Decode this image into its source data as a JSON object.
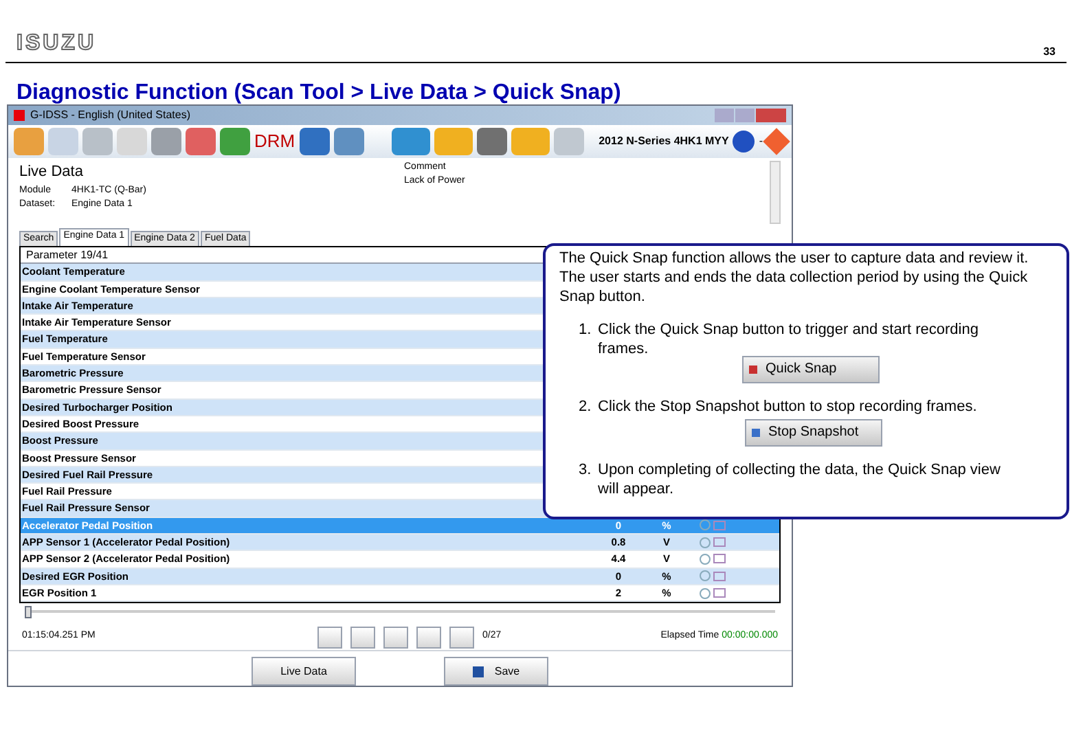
{
  "page": {
    "logo": "ISUZU",
    "number": "33",
    "title": "Diagnostic Function (Scan Tool > Live Data > Quick Snap)"
  },
  "window": {
    "title": "G-IDSS - English (United States)"
  },
  "toolbar": {
    "drm": "DRM",
    "vehicle": "2012 N-Series 4HK1 MYY",
    "separator": "-"
  },
  "header": {
    "title": "Live Data",
    "fields": [
      {
        "label": "Module",
        "value": "4HK1-TC (Q-Bar)"
      },
      {
        "label": "Dataset:",
        "value": "Engine Data 1"
      }
    ],
    "comment_label": "Comment",
    "comment": "Lack of Power"
  },
  "tabs": [
    {
      "label": "Search",
      "selected": false
    },
    {
      "label": "Engine Data 1",
      "selected": true
    },
    {
      "label": "Engine Data 2",
      "selected": false
    },
    {
      "label": "Fuel Data",
      "selected": false
    }
  ],
  "table": {
    "header": "Parameter 19/41",
    "rows": [
      {
        "name": "Coolant Temperature",
        "selected": false
      },
      {
        "name": "Engine Coolant Temperature Sensor",
        "selected": false
      },
      {
        "name": "Intake Air Temperature",
        "selected": false
      },
      {
        "name": "Intake Air Temperature Sensor",
        "selected": false
      },
      {
        "name": "Fuel Temperature",
        "selected": false
      },
      {
        "name": "Fuel Temperature Sensor",
        "selected": false
      },
      {
        "name": "Barometric Pressure",
        "selected": false
      },
      {
        "name": "Barometric Pressure Sensor",
        "selected": false
      },
      {
        "name": "Desired Turbocharger Position",
        "selected": false
      },
      {
        "name": "Desired Boost Pressure",
        "selected": false
      },
      {
        "name": "Boost Pressure",
        "selected": false
      },
      {
        "name": "Boost Pressure Sensor",
        "selected": false
      },
      {
        "name": "Desired Fuel Rail Pressure",
        "selected": false
      },
      {
        "name": "Fuel Rail Pressure",
        "selected": false
      },
      {
        "name": "Fuel Rail Pressure Sensor",
        "selected": false
      },
      {
        "name": "Accelerator Pedal Position",
        "value": "0",
        "unit": "%",
        "selected": true
      },
      {
        "name": "APP Sensor 1 (Accelerator Pedal Position)",
        "value": "0.8",
        "unit": "V",
        "selected": false
      },
      {
        "name": "APP Sensor 2 (Accelerator Pedal Position)",
        "value": "4.4",
        "unit": "V",
        "selected": false
      },
      {
        "name": "Desired EGR Position",
        "value": "0",
        "unit": "%",
        "selected": false
      },
      {
        "name": "EGR Position 1",
        "value": "2",
        "unit": "%",
        "selected": false
      }
    ]
  },
  "playback": {
    "level": 0.0,
    "time": "01:15:04.251 PM",
    "frame": "0/27",
    "elapsed_label": "Elapsed Time",
    "elapsed": "00:00:00.000"
  },
  "buttons": [
    "Live Data",
    "Save"
  ],
  "callout": {
    "intro": "The Quick Snap function allows the user to capture data and review it.  The user starts and ends the data collection period by using the Quick Snap button.",
    "steps": [
      {
        "number": "1.",
        "text": "Click the Quick Snap button to trigger and start recording frames.",
        "button": "Quick Snap",
        "kind": "quick"
      },
      {
        "number": "2.",
        "text": "Click the Stop Snapshot button to stop recording frames.",
        "button": "Stop Snapshot",
        "kind": "stop"
      },
      {
        "number": "3.",
        "text": "Upon completing of collecting the data, the Quick Snap view will appear."
      }
    ]
  }
}
